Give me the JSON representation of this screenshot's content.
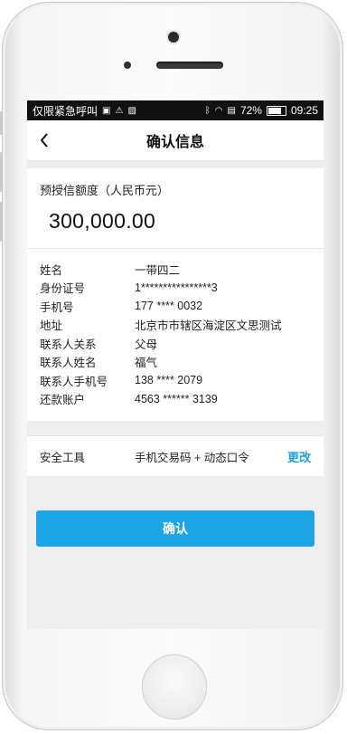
{
  "status_bar": {
    "carrier": "仅限紧急呼叫",
    "battery": "72%",
    "time": "09:25"
  },
  "nav": {
    "title": "确认信息"
  },
  "amount": {
    "label": "预授信额度（人民币元）",
    "value": "300,000.00"
  },
  "info": [
    {
      "key": "姓名",
      "value": "一带四二"
    },
    {
      "key": "身份证号",
      "value": "1****************3"
    },
    {
      "key": "手机号",
      "value": "177 **** 0032"
    },
    {
      "key": "地址",
      "value": "北京市市辖区海淀区文思测试"
    },
    {
      "key": "联系人关系",
      "value": "父母"
    },
    {
      "key": "联系人姓名",
      "value": "福气"
    },
    {
      "key": "联系人手机号",
      "value": "138 **** 2079"
    },
    {
      "key": "还款账户",
      "value": "4563 ****** 3139"
    }
  ],
  "security": {
    "label": "安全工具",
    "value": "手机交易码 + 动态口令",
    "change_label": "更改"
  },
  "confirm_button": "确认",
  "colors": {
    "accent": "#1da4e6",
    "link": "#1da1e0",
    "background": "#eeeeef"
  },
  "icons": [
    "back-arrow-icon",
    "bluetooth-icon",
    "wifi-icon",
    "sim-icon",
    "battery-icon",
    "warning-icon",
    "image-icon",
    "sim-card-icon"
  ]
}
